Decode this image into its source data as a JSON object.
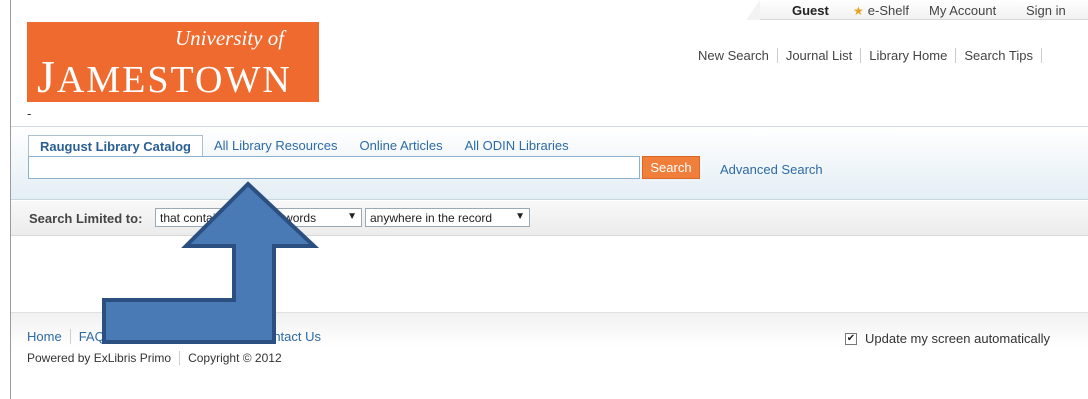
{
  "userbar": {
    "guest": "Guest",
    "eshelf": "e-Shelf",
    "my_account": "My Account",
    "sign_in": "Sign in",
    "star_icon": "star-icon"
  },
  "logo": {
    "top_text": "University of",
    "main_text_first": "J",
    "main_text_rest": "AMESTOWN",
    "color": "#ef6a2f"
  },
  "under_logo": "-",
  "topnav": [
    "New Search",
    "Journal List",
    "Library Home",
    "Search Tips"
  ],
  "search": {
    "tabs": [
      "Raugust Library Catalog",
      "All Library Resources",
      "Online Articles",
      "All ODIN Libraries"
    ],
    "active_tab": 0,
    "input_value": "",
    "button_label": "Search",
    "advanced": "Advanced Search"
  },
  "filter": {
    "label": "Search Limited to:",
    "select1": "that contains my query words",
    "select2": "anywhere in the record"
  },
  "footer": {
    "links": [
      "Home",
      "FAQ",
      "Contact Us"
    ],
    "powered": "Powered by ExLibris Primo",
    "copyright": "Copyright © 2012",
    "update_label": "Update my screen automatically",
    "update_checked": true
  },
  "annotation": {
    "arrow_color": "#4a7ab5"
  }
}
